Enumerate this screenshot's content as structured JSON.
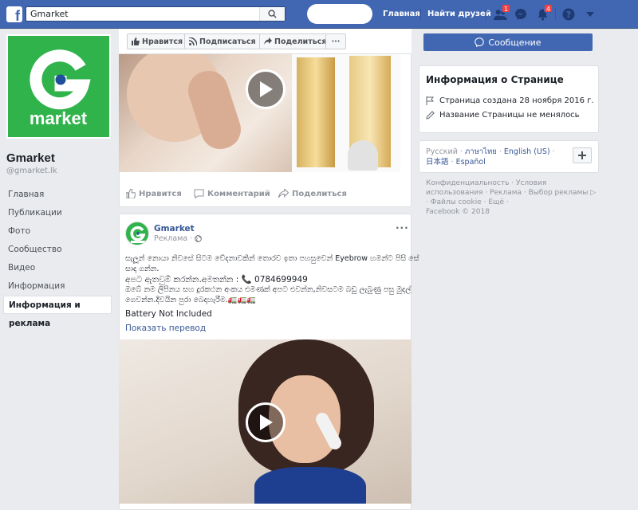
{
  "topbar": {
    "search_value": "Gmarket",
    "nav_home": "Главная",
    "nav_find_friends": "Найти друзей",
    "friend_requests_count": "1",
    "notifications_count": "4",
    "brand_color": "#4267b2"
  },
  "page": {
    "logo_text": "market",
    "name": "Gmarket",
    "handle": "@gmarket.lk"
  },
  "left_nav": {
    "items": [
      {
        "label": "Главная"
      },
      {
        "label": "Публикации"
      },
      {
        "label": "Фото"
      },
      {
        "label": "Сообщество"
      },
      {
        "label": "Видео"
      },
      {
        "label": "Информация"
      },
      {
        "label": "Информация и реклама"
      }
    ]
  },
  "action_bar": {
    "like": "Нравится",
    "subscribe": "Подписаться",
    "share": "Поделиться",
    "more": "···"
  },
  "post1": {
    "react_like": "Нравится",
    "react_comment": "Комментарий",
    "react_share": "Поделиться"
  },
  "post2": {
    "author": "Gmarket",
    "sponsored": "Реклама",
    "more": "···",
    "lines": [
      "සැලූන් නොයා නිවසේ සිටම වේදනාවකින් තොරව ඉතා පහසුවෙන් Eyebrow හමන්ට පිසි සේ",
      "සාදා ගන්න.",
      "අපට ඇතවුම් කරන්න.අමතන්න : 📞 0784699949",
      "ඔබේ නම ලිපිනය සහ දුරකථන අංකය එමණක් අපට එවන්න,නිවසටම බඩු ලැබුණු පසු මුදල්",
      "ගෙවන්න.දිවයින පුරා බෙදාහැරීම.🚛🚛🚛"
    ],
    "battery": "Battery Not Included",
    "translate": "Показать перевод"
  },
  "right": {
    "message_button": "Сообщение",
    "info_title": "Информация о Странице",
    "created": "Страница создана 28 ноября 2016 г.",
    "name_unchanged": "Название Страницы не менялось",
    "languages": [
      "Русский",
      "ภาษาไทย",
      "English (US)",
      "日本語",
      "Español"
    ],
    "footer_lines": [
      "Конфиденциальность · Условия",
      "использования · Реклама · Выбор рекламы ▷",
      "· Файлы cookie · Ещё ·",
      "Facebook © 2018"
    ]
  }
}
